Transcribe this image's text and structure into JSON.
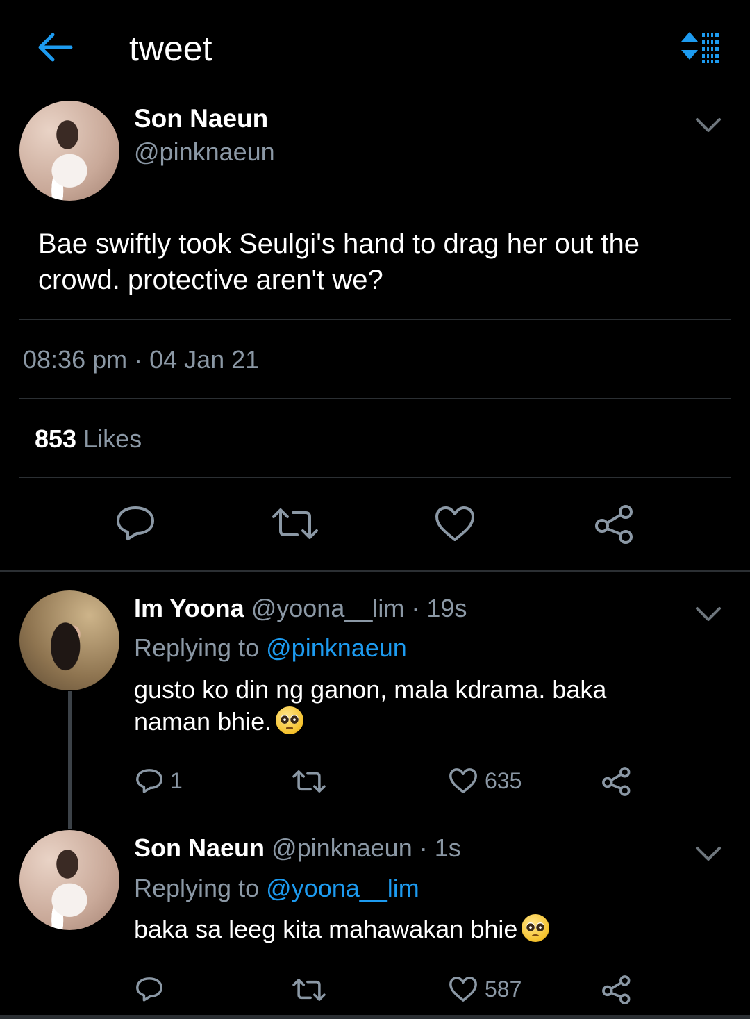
{
  "header": {
    "title": "tweet",
    "back_icon": "arrow-left-icon",
    "sort_icon": "sort-list-icon",
    "accent": "#1d9bf0"
  },
  "main_tweet": {
    "author_name": "Son Naeun",
    "author_handle": "@pinknaeun",
    "text": "Bae swiftly took Seulgi's hand to drag her out the crowd. protective aren't we?",
    "timestamp": "08:36 pm · 04 Jan 21",
    "likes_count": "853",
    "likes_label": "Likes",
    "actions": [
      "reply-icon",
      "retweet-icon",
      "like-icon",
      "share-icon"
    ]
  },
  "replies": [
    {
      "author_name": "Im Yoona",
      "author_handle": "@yoona__lim",
      "time": "· 19s",
      "replying_label": "Replying to",
      "replying_to": "@pinknaeun",
      "text": "gusto ko din ng ganon, mala kdrama. baka naman bhie.",
      "emoji": "pleading-face-emoji",
      "reply_count": "1",
      "retweet_count": "",
      "like_count": "635"
    },
    {
      "author_name": "Son Naeun",
      "author_handle": "@pinknaeun",
      "time": "· 1s",
      "replying_label": "Replying to",
      "replying_to": "@yoona__lim",
      "text": "baka sa leeg kita mahawakan bhie",
      "emoji": "pleading-face-emoji",
      "reply_count": "",
      "retweet_count": "",
      "like_count": "587"
    }
  ]
}
